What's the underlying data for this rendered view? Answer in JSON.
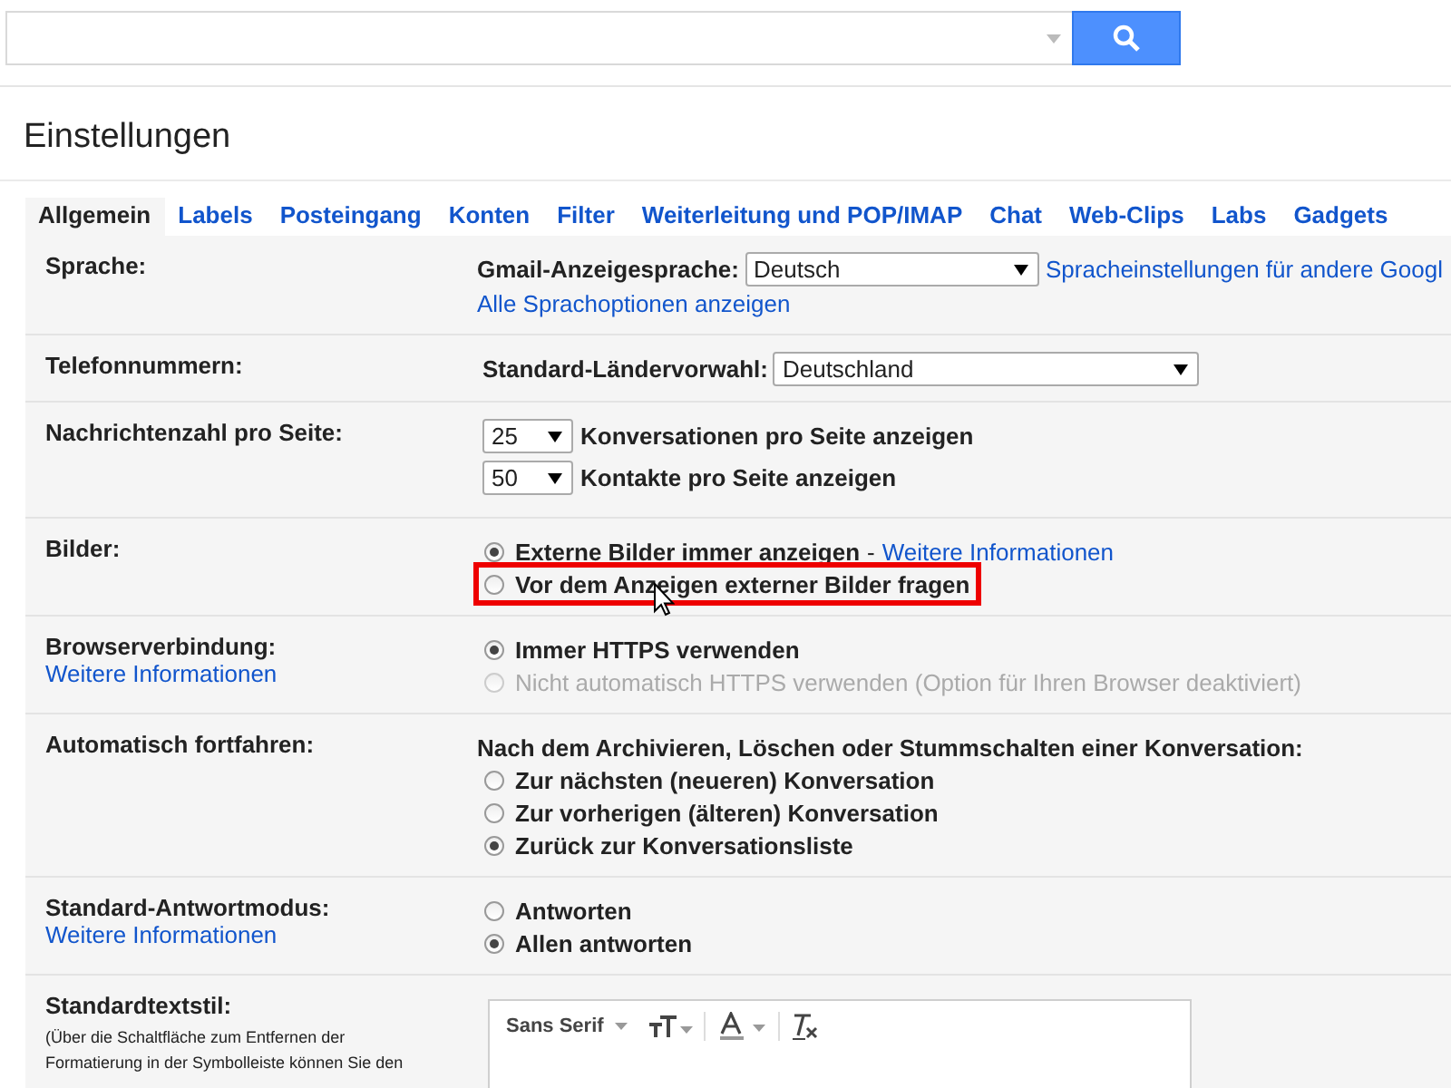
{
  "title": "Einstellungen",
  "tabs": [
    {
      "label": "Allgemein",
      "selected": true
    },
    {
      "label": "Labels",
      "selected": false
    },
    {
      "label": "Posteingang",
      "selected": false
    },
    {
      "label": "Konten",
      "selected": false
    },
    {
      "label": "Filter",
      "selected": false
    },
    {
      "label": "Weiterleitung und POP/IMAP",
      "selected": false
    },
    {
      "label": "Chat",
      "selected": false
    },
    {
      "label": "Web-Clips",
      "selected": false
    },
    {
      "label": "Labs",
      "selected": false
    },
    {
      "label": "Gadgets",
      "selected": false
    }
  ],
  "sections": [
    {
      "label": "Sprache:",
      "lines": [
        {
          "kind": "language-select",
          "label": "Gmail-Anzeigesprache:",
          "value": "Deutsch",
          "link": "Spracheinstellungen für andere Googl"
        },
        {
          "kind": "link",
          "text": "Alle Sprachoptionen anzeigen"
        }
      ]
    },
    {
      "label": "Telefonnummern:",
      "lines": [
        {
          "kind": "country-select",
          "label": "Standard-Ländervorwahl:",
          "value": "Deutschland"
        }
      ]
    },
    {
      "label": "Nachrichtenzahl pro Seite:",
      "lines": [
        {
          "kind": "count-select",
          "value": "25",
          "label": "Konversationen pro Seite anzeigen"
        },
        {
          "kind": "count-select",
          "value": "50",
          "label": "Kontakte pro Seite anzeigen"
        }
      ]
    },
    {
      "label": "Bilder:",
      "lines": [
        {
          "kind": "radio",
          "text": "Externe Bilder immer anzeigen",
          "separator": "-",
          "link": "Weitere Informationen",
          "selected": true,
          "disabled": false,
          "highlighted": false
        },
        {
          "kind": "radio",
          "text": "Vor dem Anzeigen externer Bilder fragen",
          "selected": false,
          "disabled": false,
          "highlighted": true
        }
      ]
    },
    {
      "label": "Browserverbindung:",
      "link": "Weitere Informationen",
      "lines": [
        {
          "kind": "radio",
          "text": "Immer HTTPS verwenden",
          "selected": true,
          "disabled": false,
          "highlighted": false
        },
        {
          "kind": "radio",
          "text": "Nicht automatisch HTTPS verwenden (Option für Ihren Browser deaktiviert)",
          "selected": false,
          "disabled": true,
          "highlighted": false
        }
      ]
    },
    {
      "label": "Automatisch fortfahren:",
      "lines": [
        {
          "kind": "heading",
          "text": "Nach dem Archivieren, Löschen oder Stummschalten einer Konversation:"
        },
        {
          "kind": "radio",
          "text": "Zur nächsten (neueren) Konversation",
          "selected": false,
          "disabled": false,
          "highlighted": false
        },
        {
          "kind": "radio",
          "text": "Zur vorherigen (älteren) Konversation",
          "selected": false,
          "disabled": false,
          "highlighted": false
        },
        {
          "kind": "radio",
          "text": "Zurück zur Konversationsliste",
          "selected": true,
          "disabled": false,
          "highlighted": false
        }
      ]
    },
    {
      "label": "Standard-Antwortmodus:",
      "link": "Weitere Informationen",
      "lines": [
        {
          "kind": "radio",
          "text": "Antworten",
          "selected": false,
          "disabled": false,
          "highlighted": false
        },
        {
          "kind": "radio",
          "text": "Allen antworten",
          "selected": true,
          "disabled": false,
          "highlighted": false
        }
      ]
    },
    {
      "label": "Standardtextstil:",
      "note": "(Über die Schaltfläche zum Entfernen der Formatierung in der Symbolleiste können Sie den",
      "lines": [
        {
          "kind": "editor",
          "font": "Sans Serif"
        }
      ]
    }
  ]
}
